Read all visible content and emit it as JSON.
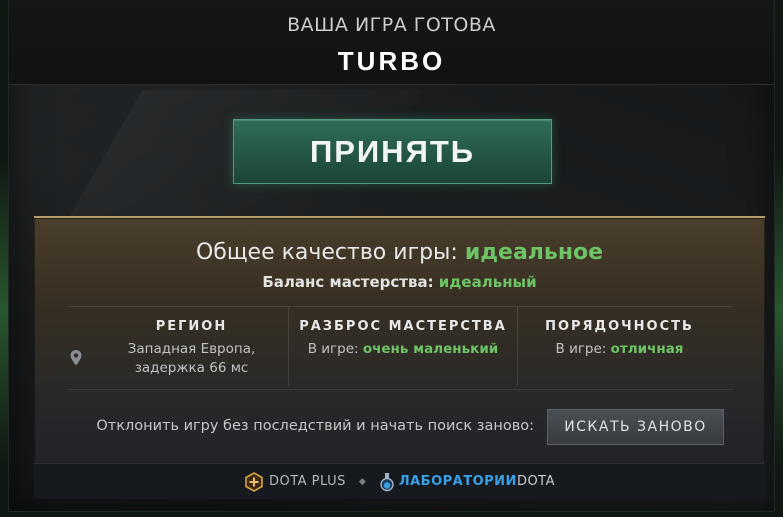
{
  "header": {
    "subtitle": "ВАША ИГРА ГОТОВА",
    "mode": "TURBO"
  },
  "accept_button": {
    "label": "ПРИНЯТЬ"
  },
  "quality": {
    "label": "Общее качество игры:",
    "value": "идеальное",
    "balance_label": "Баланс мастерства:",
    "balance_value": "идеальный"
  },
  "columns": {
    "region": {
      "heading": "РЕГИОН",
      "line1": "Западная Европа,",
      "line2": "задержка 66 мс"
    },
    "skill_spread": {
      "heading": "РАЗБРОС МАСТЕРСТВА",
      "prefix": "В игре:",
      "value": "очень маленький"
    },
    "behavior": {
      "heading": "ПОРЯДОЧНОСТЬ",
      "prefix": "В игре:",
      "value": "отличная"
    }
  },
  "decline": {
    "text": "Отклонить игру без последствий и начать поиск заново:",
    "button_label": "ИСКАТЬ ЗАНОВО"
  },
  "footer": {
    "dota_plus": "DOTA PLUS",
    "labs_part1": "ЛАБОРАТОРИИ",
    "labs_part2": "DOTA",
    "separator": "◆"
  },
  "colors": {
    "accent_green": "#6dc365",
    "accept_bg": "#2a6450",
    "labs_blue": "#3aa0e6",
    "dota_plus_gold": "#d9a441"
  },
  "icons": [
    "map-pin-icon",
    "dota-plus-icon",
    "dota-labs-icon"
  ]
}
